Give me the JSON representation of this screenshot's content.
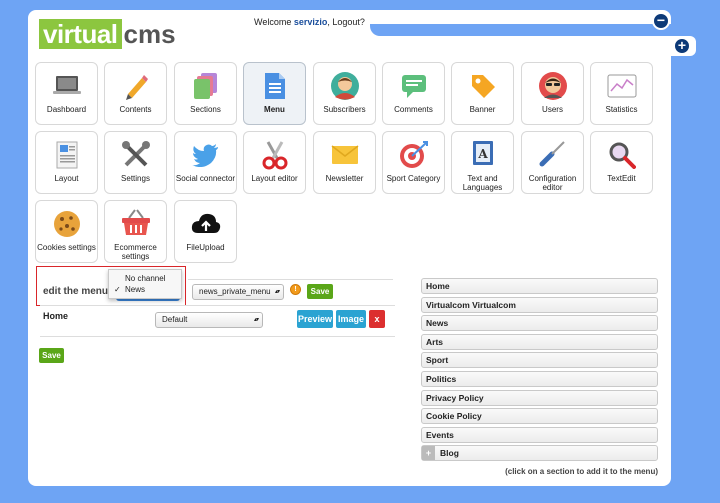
{
  "header": {
    "logo_part1": "virtual",
    "logo_part2": "cms",
    "welcome_prefix": "Welcome ",
    "username": "servizio",
    "logout": ", Logout?"
  },
  "window_controls": {
    "minus": "−",
    "plus": "+"
  },
  "tiles": [
    {
      "label": "Dashboard",
      "icon": "laptop-icon"
    },
    {
      "label": "Contents",
      "icon": "pencil-icon"
    },
    {
      "label": "Sections",
      "icon": "folders-icon"
    },
    {
      "label": "Menu",
      "icon": "document-icon",
      "active": true
    },
    {
      "label": "Subscribers",
      "icon": "person-avatar-icon"
    },
    {
      "label": "Comments",
      "icon": "chat-bubble-icon"
    },
    {
      "label": "Banner",
      "icon": "price-tag-icon"
    },
    {
      "label": "Users",
      "icon": "user-sunglasses-icon"
    },
    {
      "label": "Statistics",
      "icon": "line-chart-icon"
    },
    {
      "label": "Layout",
      "icon": "page-layout-icon"
    },
    {
      "label": "Settings",
      "icon": "tools-icon"
    },
    {
      "label": "Social connector",
      "icon": "twitter-bird-icon"
    },
    {
      "label": "Layout editor",
      "icon": "scissors-icon"
    },
    {
      "label": "Newsletter",
      "icon": "envelope-icon"
    },
    {
      "label": "Sport Category",
      "icon": "target-icon"
    },
    {
      "label": "Text and Languages",
      "icon": "dictionary-icon"
    },
    {
      "label": "Configuration editor",
      "icon": "screwdriver-icon"
    },
    {
      "label": "TextEdit",
      "icon": "magnifier-icon"
    },
    {
      "label": "Cookies settings",
      "icon": "cookie-icon"
    },
    {
      "label": "Ecommerce settings",
      "icon": "shopping-basket-icon"
    },
    {
      "label": "FileUpload",
      "icon": "cloud-upload-icon"
    }
  ],
  "editor": {
    "edit_label": "edit the menu",
    "channel_options": [
      "No channel",
      "News"
    ],
    "channel_selected": "News",
    "menu_select_value": "news_private_menu",
    "save_label": "Save",
    "row_label": "Home",
    "row_select_value": "Default",
    "preview_label": "Preview",
    "image_label": "Image",
    "delete_label": "x",
    "save_bottom_label": "Save"
  },
  "sections": {
    "items": [
      "Home",
      "Virtualcom Virtualcom",
      "News",
      "Arts",
      "Sport",
      "Politics",
      "Privacy Policy",
      "Cookie Policy",
      "Events",
      "Blog"
    ],
    "hint": "(click on a section to add it to the menu)"
  },
  "colors": {
    "background": "#6ea4f4",
    "brand_green": "#8cc63f",
    "button_green": "#5aa618",
    "button_blue": "#2aa3d2",
    "button_red": "#dc2f2f",
    "highlight_red": "#d9262a"
  }
}
